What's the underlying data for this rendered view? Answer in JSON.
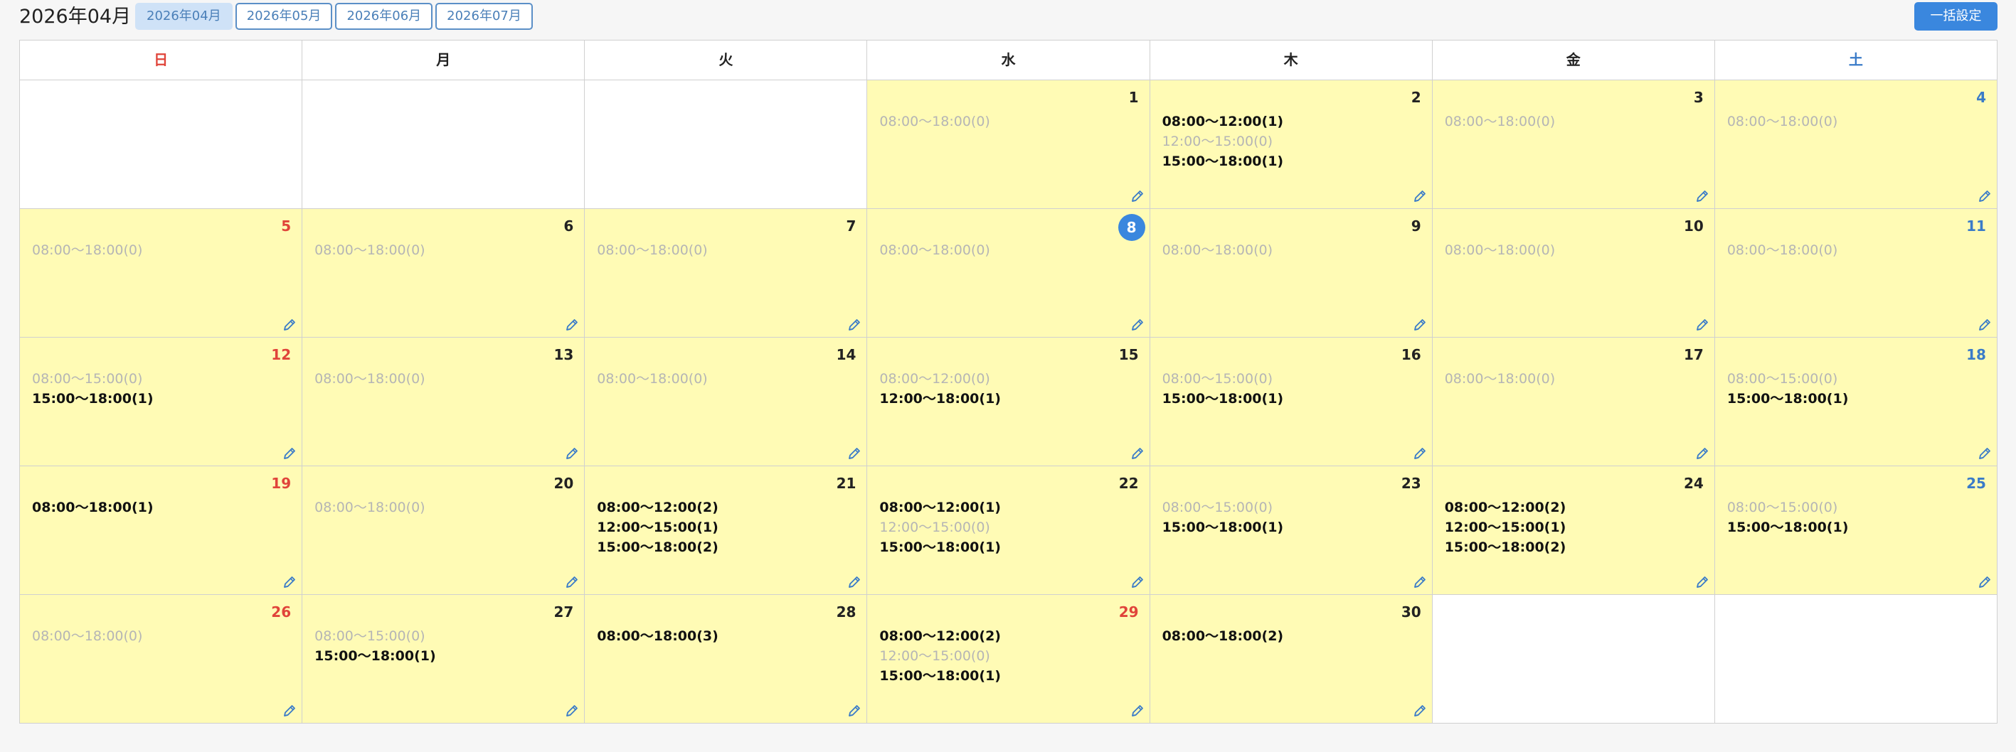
{
  "title": "2026年04月",
  "month_tabs": [
    {
      "label": "2026年04月",
      "active": true
    },
    {
      "label": "2026年05月",
      "active": false
    },
    {
      "label": "2026年06月",
      "active": false
    },
    {
      "label": "2026年07月",
      "active": false
    }
  ],
  "bulk_button": "一括設定",
  "weekdays": [
    "日",
    "月",
    "火",
    "水",
    "木",
    "金",
    "土"
  ],
  "today": 8,
  "colors": {
    "accent": "#3a87de",
    "sunday": "#e0443a",
    "saturday": "#3a7bc8",
    "active_day_bg": "#fffbb5"
  },
  "weeks": [
    [
      null,
      null,
      null,
      {
        "day": "1",
        "slots": [
          {
            "t": "08:00〜18:00(0)",
            "on": false
          }
        ]
      },
      {
        "day": "2",
        "slots": [
          {
            "t": "08:00〜12:00(1)",
            "on": true
          },
          {
            "t": "12:00〜15:00(0)",
            "on": false
          },
          {
            "t": "15:00〜18:00(1)",
            "on": true
          }
        ]
      },
      {
        "day": "3",
        "slots": [
          {
            "t": "08:00〜18:00(0)",
            "on": false
          }
        ]
      },
      {
        "day": "4",
        "slots": [
          {
            "t": "08:00〜18:00(0)",
            "on": false
          }
        ]
      }
    ],
    [
      {
        "day": "5",
        "slots": [
          {
            "t": "08:00〜18:00(0)",
            "on": false
          }
        ]
      },
      {
        "day": "6",
        "slots": [
          {
            "t": "08:00〜18:00(0)",
            "on": false
          }
        ]
      },
      {
        "day": "7",
        "slots": [
          {
            "t": "08:00〜18:00(0)",
            "on": false
          }
        ]
      },
      {
        "day": "8",
        "slots": [
          {
            "t": "08:00〜18:00(0)",
            "on": false
          }
        ]
      },
      {
        "day": "9",
        "slots": [
          {
            "t": "08:00〜18:00(0)",
            "on": false
          }
        ]
      },
      {
        "day": "10",
        "slots": [
          {
            "t": "08:00〜18:00(0)",
            "on": false
          }
        ]
      },
      {
        "day": "11",
        "slots": [
          {
            "t": "08:00〜18:00(0)",
            "on": false
          }
        ]
      }
    ],
    [
      {
        "day": "12",
        "slots": [
          {
            "t": "08:00〜15:00(0)",
            "on": false
          },
          {
            "t": "15:00〜18:00(1)",
            "on": true
          }
        ]
      },
      {
        "day": "13",
        "slots": [
          {
            "t": "08:00〜18:00(0)",
            "on": false
          }
        ]
      },
      {
        "day": "14",
        "slots": [
          {
            "t": "08:00〜18:00(0)",
            "on": false
          }
        ]
      },
      {
        "day": "15",
        "slots": [
          {
            "t": "08:00〜12:00(0)",
            "on": false
          },
          {
            "t": "12:00〜18:00(1)",
            "on": true
          }
        ]
      },
      {
        "day": "16",
        "slots": [
          {
            "t": "08:00〜15:00(0)",
            "on": false
          },
          {
            "t": "15:00〜18:00(1)",
            "on": true
          }
        ]
      },
      {
        "day": "17",
        "slots": [
          {
            "t": "08:00〜18:00(0)",
            "on": false
          }
        ]
      },
      {
        "day": "18",
        "slots": [
          {
            "t": "08:00〜15:00(0)",
            "on": false
          },
          {
            "t": "15:00〜18:00(1)",
            "on": true
          }
        ]
      }
    ],
    [
      {
        "day": "19",
        "slots": [
          {
            "t": "08:00〜18:00(1)",
            "on": true
          }
        ]
      },
      {
        "day": "20",
        "slots": [
          {
            "t": "08:00〜18:00(0)",
            "on": false
          }
        ]
      },
      {
        "day": "21",
        "slots": [
          {
            "t": "08:00〜12:00(2)",
            "on": true
          },
          {
            "t": "12:00〜15:00(1)",
            "on": true
          },
          {
            "t": "15:00〜18:00(2)",
            "on": true
          }
        ]
      },
      {
        "day": "22",
        "slots": [
          {
            "t": "08:00〜12:00(1)",
            "on": true
          },
          {
            "t": "12:00〜15:00(0)",
            "on": false
          },
          {
            "t": "15:00〜18:00(1)",
            "on": true
          }
        ]
      },
      {
        "day": "23",
        "slots": [
          {
            "t": "08:00〜15:00(0)",
            "on": false
          },
          {
            "t": "15:00〜18:00(1)",
            "on": true
          }
        ]
      },
      {
        "day": "24",
        "slots": [
          {
            "t": "08:00〜12:00(2)",
            "on": true
          },
          {
            "t": "12:00〜15:00(1)",
            "on": true
          },
          {
            "t": "15:00〜18:00(2)",
            "on": true
          }
        ]
      },
      {
        "day": "25",
        "slots": [
          {
            "t": "08:00〜15:00(0)",
            "on": false
          },
          {
            "t": "15:00〜18:00(1)",
            "on": true
          }
        ]
      }
    ],
    [
      {
        "day": "26",
        "slots": [
          {
            "t": "08:00〜18:00(0)",
            "on": false
          }
        ]
      },
      {
        "day": "27",
        "slots": [
          {
            "t": "08:00〜15:00(0)",
            "on": false
          },
          {
            "t": "15:00〜18:00(1)",
            "on": true
          }
        ]
      },
      {
        "day": "28",
        "slots": [
          {
            "t": "08:00〜18:00(3)",
            "on": true
          }
        ]
      },
      {
        "day": "29",
        "holiday": true,
        "slots": [
          {
            "t": "08:00〜12:00(2)",
            "on": true
          },
          {
            "t": "12:00〜15:00(0)",
            "on": false
          },
          {
            "t": "15:00〜18:00(1)",
            "on": true
          }
        ]
      },
      {
        "day": "30",
        "slots": [
          {
            "t": "08:00〜18:00(2)",
            "on": true
          }
        ]
      },
      null,
      null
    ]
  ]
}
